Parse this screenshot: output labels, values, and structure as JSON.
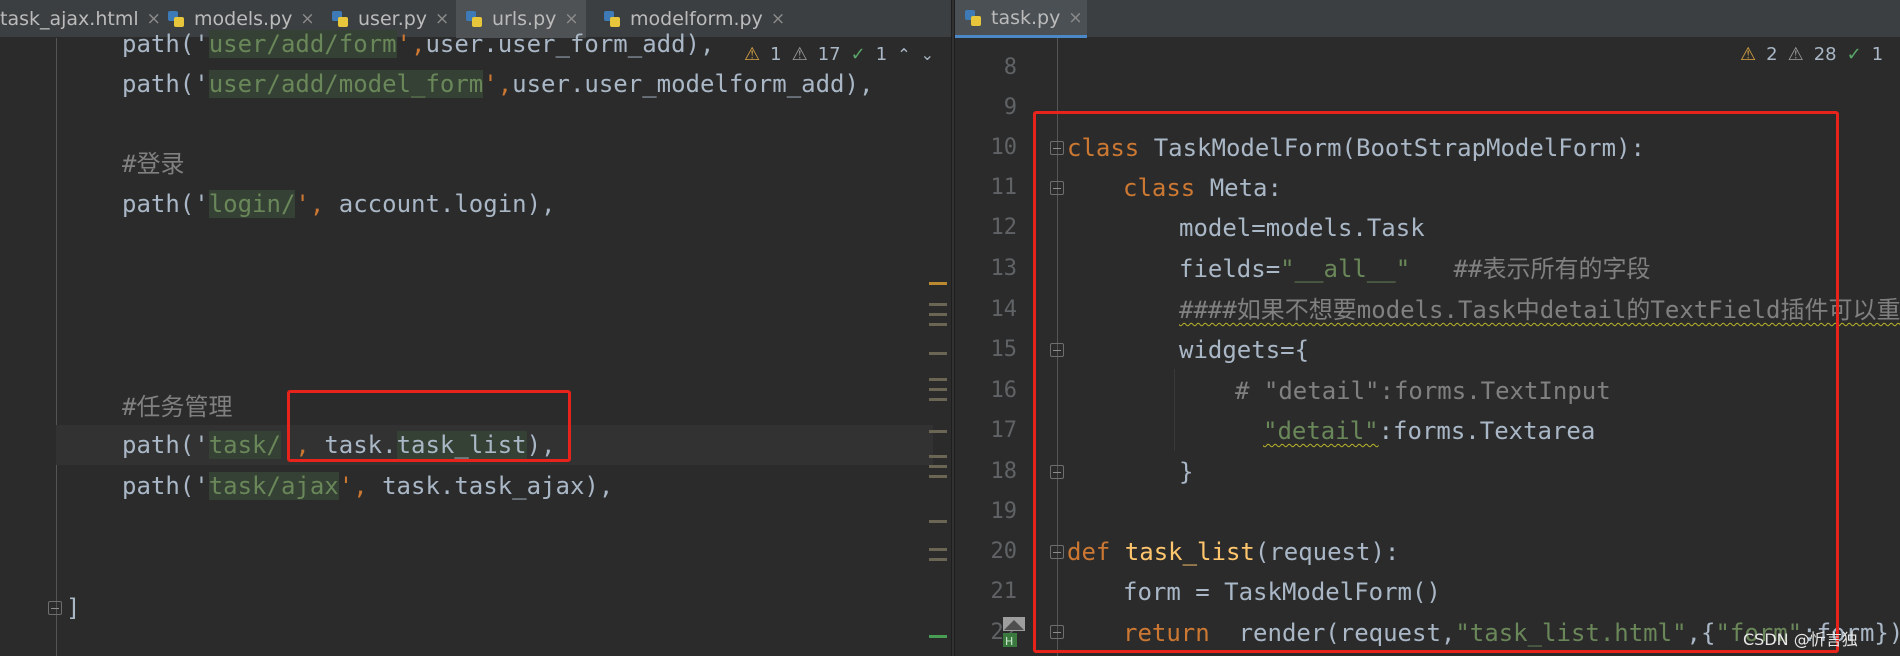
{
  "left": {
    "tabs": [
      {
        "label": "task_ajax.html",
        "close": "×"
      },
      {
        "label": "models.py",
        "close": "×"
      },
      {
        "label": "user.py",
        "close": "×"
      },
      {
        "label": "urls.py",
        "close": "×"
      },
      {
        "label": "modelform.py",
        "close": "×"
      }
    ],
    "inspections": {
      "errors": "1",
      "warnings": "17",
      "ok": "1",
      "up": "⌃",
      "down": "⌄"
    },
    "code": {
      "l0_a": "path('",
      "l0_b": "user/add/form",
      "l0_c": "',",
      "l0_d": "user.user_form_add),",
      "l1_a": "path('",
      "l1_b": "user/add/model_form",
      "l1_c": "',",
      "l1_d": "user.user_modelform_add),",
      "l2": "#登录",
      "l3_a": "path('",
      "l3_b": "login/",
      "l3_c": "', ",
      "l3_d": "account.login),",
      "l4": "#任务管理",
      "l5_a": "path('",
      "l5_b": "task/",
      "l5_c": "', ",
      "l5_d": "task.",
      "l5_e": "task_list",
      "l5_f": "),",
      "l6_a": "path('",
      "l6_b": "task/ajax",
      "l6_c": "', ",
      "l6_d": "task.task_ajax),",
      "l7": "]"
    }
  },
  "right": {
    "tab": {
      "label": "task.py",
      "close": "×"
    },
    "inspections": {
      "errors": "2",
      "warnings": "28",
      "ok": "1"
    },
    "line_numbers": [
      "8",
      "9",
      "10",
      "11",
      "12",
      "13",
      "14",
      "15",
      "16",
      "17",
      "18",
      "19",
      "20",
      "21",
      "22"
    ],
    "code": {
      "l10_kw": "class ",
      "l10_rest": "TaskModelForm(BootStrapModelForm):",
      "l11_kw": "class ",
      "l11_rest": "Meta:",
      "l12": "model=models.Task",
      "l13_a": "fields=",
      "l13_b": "\"__all__\"",
      "l13_c": "   ##表示所有的字段",
      "l14": "####如果不想要models.Task中detail的TextField插件可以重新",
      "l15": "widgets={",
      "l16": "# \"detail\":forms.TextInput",
      "l17_a": "\"detail\"",
      "l17_b": ":forms.Textarea",
      "l18": "}",
      "l20_kw": "def ",
      "l20_fn": "task_list",
      "l20_rest": "(request):",
      "l21": "form = TaskModelForm()",
      "l22_kw": "return ",
      "l22_a": " render(request,",
      "l22_b": "\"task_list.html\"",
      "l22_c": ",{",
      "l22_d": "\"form\"",
      "l22_e": ":form})"
    }
  },
  "watermark": "CSDN @忻言独",
  "colors": {
    "keyword": "#cc7832",
    "string": "#6a8759",
    "comment": "#808080",
    "function": "#ffc66d",
    "highlight_box": "#e8231c"
  }
}
